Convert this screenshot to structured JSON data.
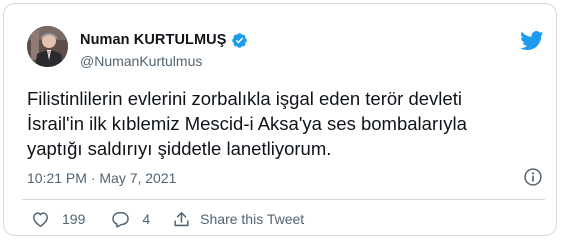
{
  "author": {
    "display_name": "Numan KURTULMUŞ",
    "handle": "@NumanKurtulmus",
    "verified": true
  },
  "tweet": {
    "text": "Filistinlilerin evlerini zorbalıkla işgal eden terör devleti\nİsrail'in ilk kıblemiz Mescid-i Aksa'ya ses bombalarıyla\nyaptığı saldırıyı şiddetle lanetliyorum.",
    "timestamp": "10:21 PM · May 7, 2021"
  },
  "actions": {
    "like_count": "199",
    "reply_count": "4",
    "share_label": "Share this Tweet"
  },
  "icons": {
    "verified": "verified-badge-icon",
    "brand": "twitter-bird-icon",
    "info": "info-icon",
    "like": "heart-icon",
    "reply": "speech-bubble-icon",
    "share": "share-arrow-icon"
  },
  "colors": {
    "brand": "#1d9bf0",
    "text_primary": "#0f1419",
    "text_secondary": "#536471",
    "border": "#cfd9de"
  }
}
